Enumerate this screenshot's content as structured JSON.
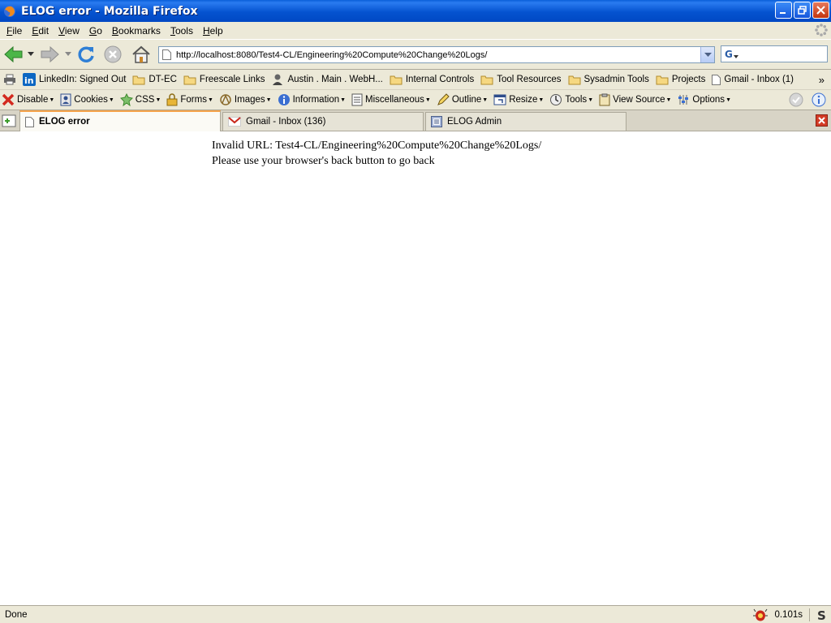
{
  "window": {
    "title": "ELOG error - Mozilla Firefox"
  },
  "menu": [
    "File",
    "Edit",
    "View",
    "Go",
    "Bookmarks",
    "Tools",
    "Help"
  ],
  "menu_underline": [
    "F",
    "E",
    "V",
    "G",
    "B",
    "T",
    "H"
  ],
  "nav": {
    "url": "http://localhost:8080/Test4-CL/Engineering%20Compute%20Change%20Logs/",
    "search_value": ""
  },
  "bookmarks": [
    {
      "label": "LinkedIn: Signed Out",
      "icon": "linkedin-icon"
    },
    {
      "label": "DT-EC",
      "icon": "folder-icon"
    },
    {
      "label": "Freescale Links",
      "icon": "folder-icon"
    },
    {
      "label": "Austin . Main . WebH...",
      "icon": "person-icon"
    },
    {
      "label": "Internal Controls",
      "icon": "folder-icon"
    },
    {
      "label": "Tool Resources",
      "icon": "folder-icon"
    },
    {
      "label": "Sysadmin Tools",
      "icon": "folder-icon"
    },
    {
      "label": "Projects",
      "icon": "folder-icon"
    },
    {
      "label": "Gmail - Inbox (1)",
      "icon": "page-icon"
    }
  ],
  "devtoolbar": [
    {
      "label": "Disable",
      "icon": "disable-icon"
    },
    {
      "label": "Cookies",
      "icon": "cookies-icon"
    },
    {
      "label": "CSS",
      "icon": "css-icon"
    },
    {
      "label": "Forms",
      "icon": "forms-icon"
    },
    {
      "label": "Images",
      "icon": "images-icon"
    },
    {
      "label": "Information",
      "icon": "information-icon"
    },
    {
      "label": "Miscellaneous",
      "icon": "miscellaneous-icon"
    },
    {
      "label": "Outline",
      "icon": "outline-icon"
    },
    {
      "label": "Resize",
      "icon": "resize-icon"
    },
    {
      "label": "Tools",
      "icon": "tools-icon"
    },
    {
      "label": "View Source",
      "icon": "view-source-icon"
    },
    {
      "label": "Options",
      "icon": "options-icon"
    }
  ],
  "tabs": [
    {
      "label": "ELOG error",
      "active": true,
      "icon": "page-icon"
    },
    {
      "label": "Gmail - Inbox (136)",
      "active": false,
      "icon": "gmail-icon"
    },
    {
      "label": "ELOG Admin",
      "active": false,
      "icon": "elog-icon"
    }
  ],
  "content": {
    "line1": "Invalid URL: Test4-CL/Engineering%20Compute%20Change%20Logs/",
    "line2": "Please use your browser's back button to go back"
  },
  "status": {
    "text": "Done",
    "timer": "0.101s"
  },
  "colors": {
    "titlebar": "#0553d0",
    "chrome": "#ece9d8",
    "active_tab_accent": "#f6a34a"
  }
}
